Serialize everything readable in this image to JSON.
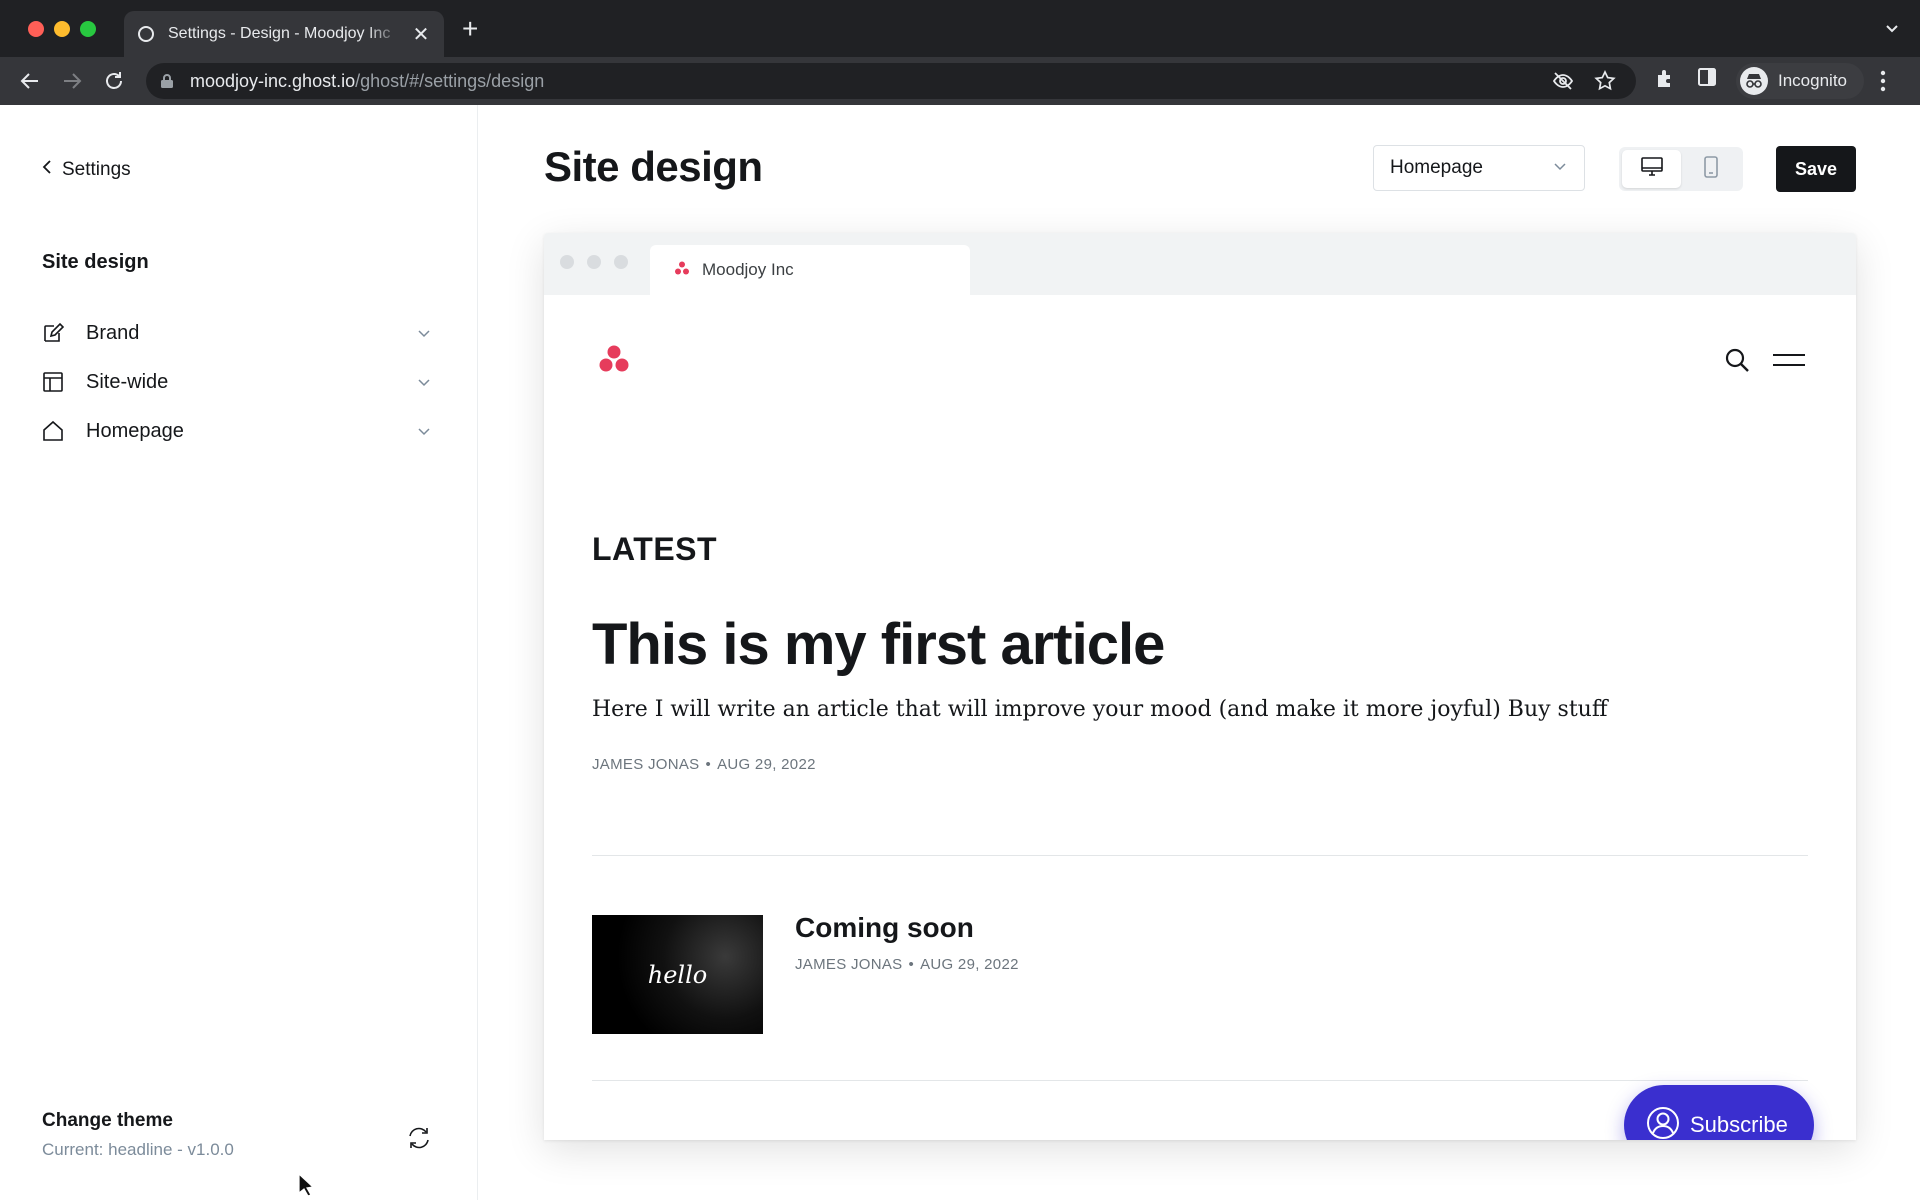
{
  "browser": {
    "tab_title": "Settings - Design - Moodjoy Inc",
    "url_host": "moodjoy-inc.ghost.io",
    "url_path": "/ghost/#/settings/design",
    "profile_label": "Incognito"
  },
  "sidebar": {
    "back_label": "Settings",
    "heading": "Site design",
    "items": [
      {
        "label": "Brand",
        "icon": "brush-icon"
      },
      {
        "label": "Site-wide",
        "icon": "layout-icon"
      },
      {
        "label": "Homepage",
        "icon": "home-icon"
      }
    ],
    "change_theme": {
      "title": "Change theme",
      "current": "Current: headline - v1.0.0"
    }
  },
  "header": {
    "title": "Site design",
    "page_select_value": "Homepage",
    "save_label": "Save",
    "device_active": "desktop"
  },
  "preview": {
    "tab_label": "Moodjoy Inc",
    "section_label": "LATEST",
    "featured": {
      "title": "This is my first article",
      "excerpt": "Here I will write an article that will improve your mood (and make it more joyful) Buy stuff",
      "author": "JAMES JONAS",
      "date": "AUG 29, 2022"
    },
    "posts": [
      {
        "title": "Coming soon",
        "author": "JAMES JONAS",
        "date": "AUG 29, 2022",
        "thumb_text": "hello"
      }
    ],
    "subscribe_label": "Subscribe",
    "accent": "#3a2fcf",
    "logo_color": "#e63c5c"
  }
}
